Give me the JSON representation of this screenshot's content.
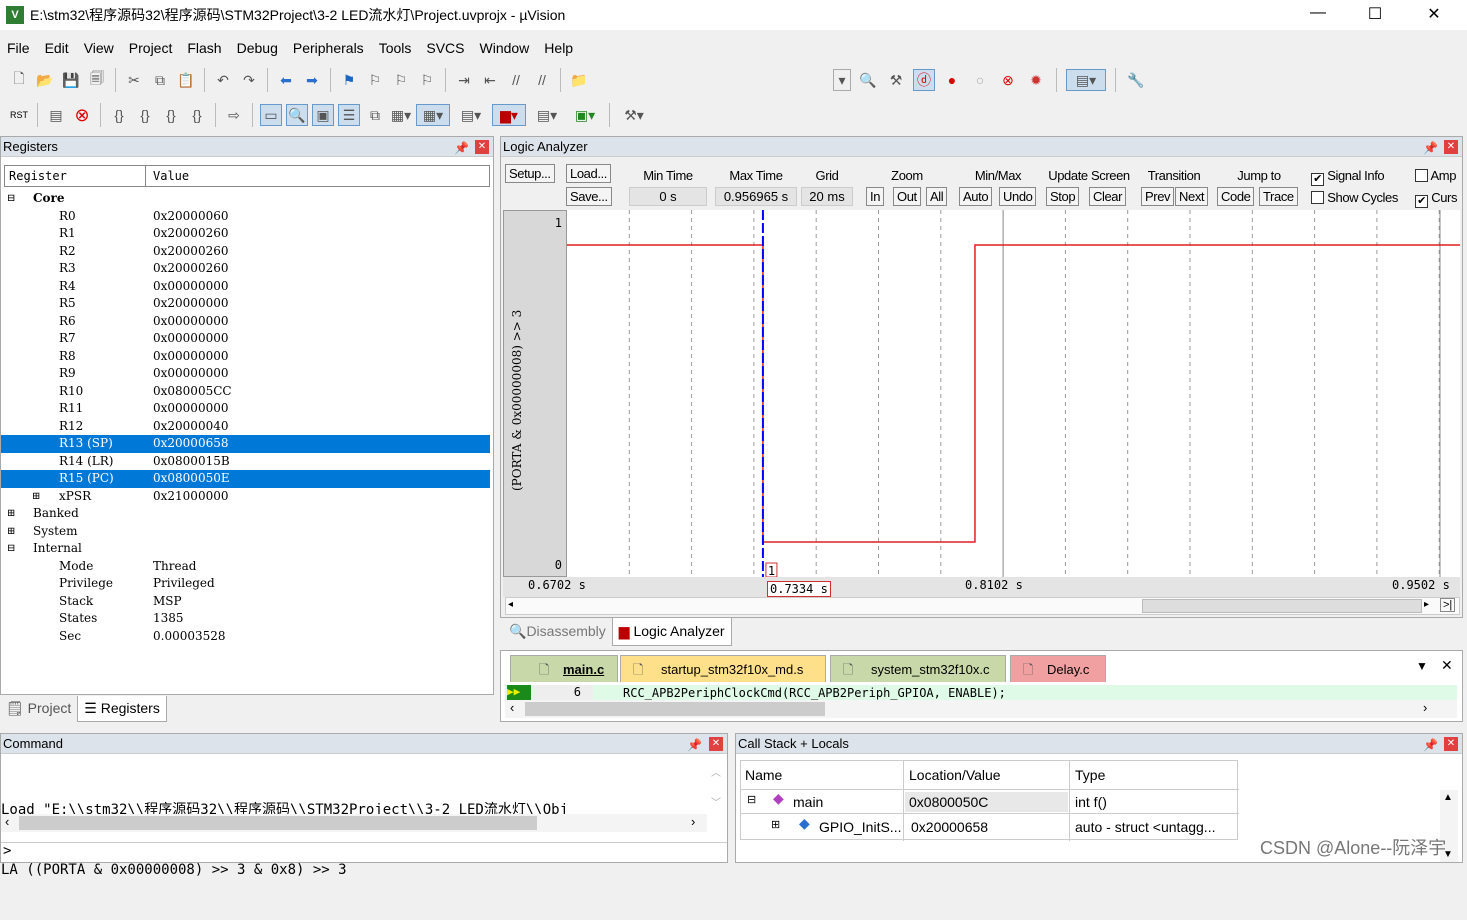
{
  "window": {
    "title": "E:\\stm32\\程序源码32\\程序源码\\STM32Project\\3-2 LED流水灯\\Project.uvprojx - µVision",
    "minimize": "—",
    "maximize": "☐",
    "close": "✕"
  },
  "menu": [
    "File",
    "Edit",
    "View",
    "Project",
    "Flash",
    "Debug",
    "Peripherals",
    "Tools",
    "SVCS",
    "Window",
    "Help"
  ],
  "registers": {
    "title": "Registers",
    "col_register": "Register",
    "col_value": "Value",
    "core_label": "Core",
    "core": [
      {
        "n": "R0",
        "v": "0x20000060"
      },
      {
        "n": "R1",
        "v": "0x20000260"
      },
      {
        "n": "R2",
        "v": "0x20000260"
      },
      {
        "n": "R3",
        "v": "0x20000260"
      },
      {
        "n": "R4",
        "v": "0x00000000"
      },
      {
        "n": "R5",
        "v": "0x20000000"
      },
      {
        "n": "R6",
        "v": "0x00000000"
      },
      {
        "n": "R7",
        "v": "0x00000000"
      },
      {
        "n": "R8",
        "v": "0x00000000"
      },
      {
        "n": "R9",
        "v": "0x00000000"
      },
      {
        "n": "R10",
        "v": "0x080005CC"
      },
      {
        "n": "R11",
        "v": "0x00000000"
      },
      {
        "n": "R12",
        "v": "0x20000040"
      },
      {
        "n": "R13 (SP)",
        "v": "0x20000658",
        "sel": true
      },
      {
        "n": "R14 (LR)",
        "v": "0x0800015B"
      },
      {
        "n": "R15 (PC)",
        "v": "0x0800050E",
        "sel": true
      },
      {
        "n": "xPSR",
        "v": "0x21000000"
      }
    ],
    "groups": [
      "Banked",
      "System",
      "Internal"
    ],
    "internal": [
      {
        "n": "Mode",
        "v": "Thread"
      },
      {
        "n": "Privilege",
        "v": "Privileged"
      },
      {
        "n": "Stack",
        "v": "MSP"
      },
      {
        "n": "States",
        "v": "1385"
      },
      {
        "n": "Sec",
        "v": "0.00003528"
      }
    ]
  },
  "left_tabs": [
    "Project",
    "Registers"
  ],
  "logic": {
    "title": "Logic Analyzer",
    "setup": "Setup...",
    "load": "Load...",
    "save": "Save...",
    "min_time_label": "Min Time",
    "min_time": "0 s",
    "max_time_label": "Max Time",
    "max_time": "0.956965 s",
    "grid_label": "Grid",
    "grid": "20 ms",
    "zoom_label": "Zoom",
    "zoom_in": "In",
    "zoom_out": "Out",
    "zoom_all": "All",
    "minmax_label": "Min/Max",
    "auto": "Auto",
    "undo": "Undo",
    "update_label": "Update Screen",
    "stop": "Stop",
    "clear": "Clear",
    "transition_label": "Transition",
    "prev": "Prev",
    "next": "Next",
    "jump_label": "Jump to",
    "code": "Code",
    "trace": "Trace",
    "signal_info": "Signal Info",
    "signal_info_checked": true,
    "show_cycles": "Show Cycles",
    "show_cycles_checked": false,
    "amp": "Amp",
    "amp_checked": false,
    "cursor": "Curs",
    "cursor_checked": true,
    "signal_name": "(PORTA & 0x00000008) >> 3",
    "y_max": "1",
    "y_min": "0",
    "t_start": "0.6702 s",
    "t_cursor": "0.7334 s",
    "t_mid": "0.8102 s",
    "t_end": "0.9502 s",
    "cursor_value": "1",
    "waveform": [
      {
        "t": 0.6702,
        "v": 1
      },
      {
        "t": 0.7334,
        "v": 0
      },
      {
        "t": 0.8018,
        "v": 1
      },
      {
        "t": 0.9502,
        "v": 1
      }
    ],
    "signal_color": "#e02020",
    "cursor_color": "#0000ff"
  },
  "bottom_tabs": [
    "Disassembly",
    "Logic Analyzer"
  ],
  "editor": {
    "tabs": [
      {
        "label": "main.c",
        "color": "#c8d8a8"
      },
      {
        "label": "startup_stm32f10x_md.s",
        "color": "#ffe08a"
      },
      {
        "label": "system_stm32f10x.c",
        "color": "#c8d8a8"
      },
      {
        "label": "Delay.c",
        "color": "#f0a0a0"
      }
    ],
    "line_no": "6",
    "line": "RCC_APB2PeriphClockCmd(RCC_APB2Periph_GPIOA, ENABLE);"
  },
  "command": {
    "title": "Command",
    "lines": [
      "Load \"E:\\\\stm32\\\\程序源码32\\\\程序源码\\\\STM32Project\\\\3-2 LED流水灯\\\\Obj",
      "LA ((PORTA & 0x00000008) >> 3 & 0x8) >> 3"
    ],
    "prompt": ">"
  },
  "callstack": {
    "title": "Call Stack + Locals",
    "cols": [
      "Name",
      "Location/Value",
      "Type"
    ],
    "rows": [
      {
        "name": "main",
        "loc": "0x0800050C",
        "type": "int f()"
      },
      {
        "name": "GPIO_InitS...",
        "loc": "0x20000658",
        "type": "auto - struct <untagg..."
      }
    ]
  },
  "watermark": "CSDN @Alone--阮泽宇"
}
